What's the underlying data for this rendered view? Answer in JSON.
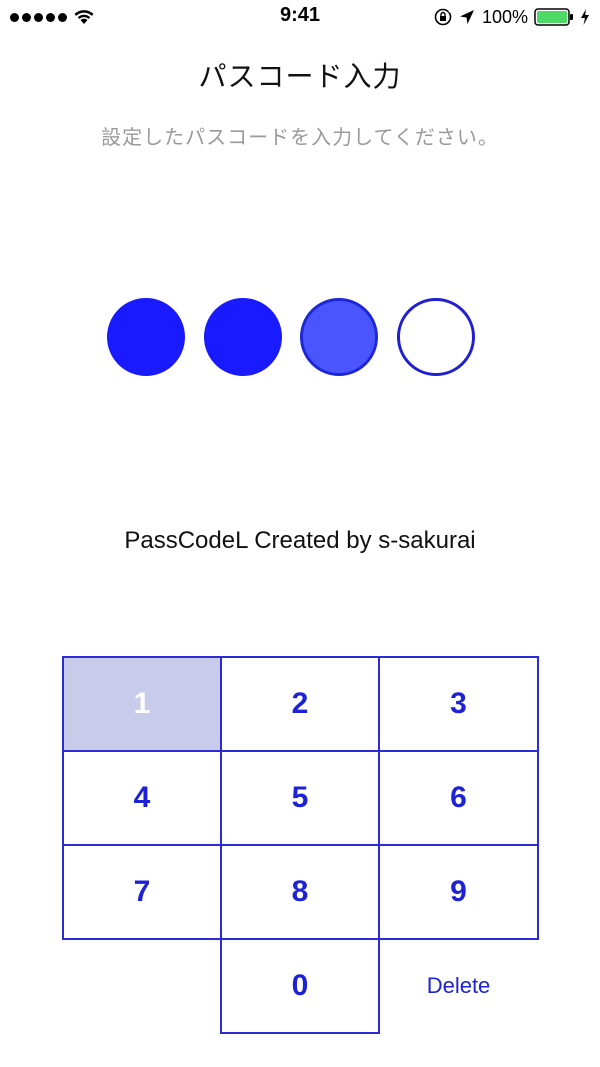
{
  "status_bar": {
    "time": "9:41",
    "battery_percent": "100%",
    "signal_bars": 5
  },
  "screen": {
    "title": "パスコード入力",
    "subtitle": "設定したパスコードを入力してください。",
    "credit": "PassCodeL Created by s-sakurai"
  },
  "passcode": {
    "length": 4,
    "entered": 3,
    "states": [
      "filled",
      "filled",
      "active",
      "empty"
    ]
  },
  "keypad": {
    "keys": [
      "1",
      "2",
      "3",
      "4",
      "5",
      "6",
      "7",
      "8",
      "9",
      "0"
    ],
    "pressed_key": "1",
    "delete_label": "Delete"
  },
  "colors": {
    "accent": "#1a1aff",
    "key_border": "#2a2ad8",
    "pressed_key_bg": "#c9cbea",
    "subtitle_text": "#9a9a9a",
    "battery": "#4cd964"
  }
}
